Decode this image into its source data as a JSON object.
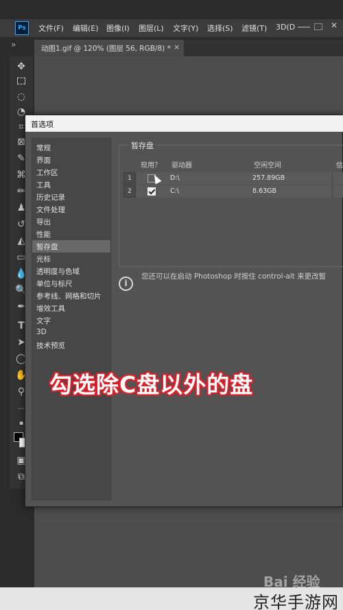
{
  "app": {
    "logo": "Ps",
    "menus": [
      "文件(F)",
      "编辑(E)",
      "图像(I)",
      "图层(L)",
      "文字(Y)",
      "选择(S)",
      "滤镜(T)",
      "3D(D"
    ],
    "document_tab": "动图1.gif @ 120% (图层 56, RGB/8) *",
    "close_symbol": "×",
    "panel_toggle": "»"
  },
  "dialog": {
    "title": "首选项",
    "nav_items": [
      "常规",
      "界面",
      "工作区",
      "工具",
      "历史记录",
      "文件处理",
      "导出",
      "性能",
      "暂存盘",
      "光标",
      "透明度与色域",
      "单位与标尺",
      "参考线、网格和切片",
      "增效工具",
      "文字",
      "3D",
      "技术预览"
    ],
    "active_nav": "暂存盘",
    "section_title": "暂存盘",
    "columns": [
      "现用？",
      "驱动器",
      "空闲空间",
      "信"
    ],
    "rows": [
      {
        "num": "1",
        "checked": false,
        "drive": "D:\\",
        "space": "257.89GB"
      },
      {
        "num": "2",
        "checked": true,
        "drive": "C:\\",
        "space": "8.63GB"
      }
    ],
    "info_text": "您还可以在启动 Photoshop 时按住 control-alt 来更改暂"
  },
  "overlay": {
    "caption": "勾选除C盘以外的盘",
    "color": "#e0202b"
  },
  "watermark": {
    "baidu": "Bai 经验",
    "site": "京华手游网"
  }
}
